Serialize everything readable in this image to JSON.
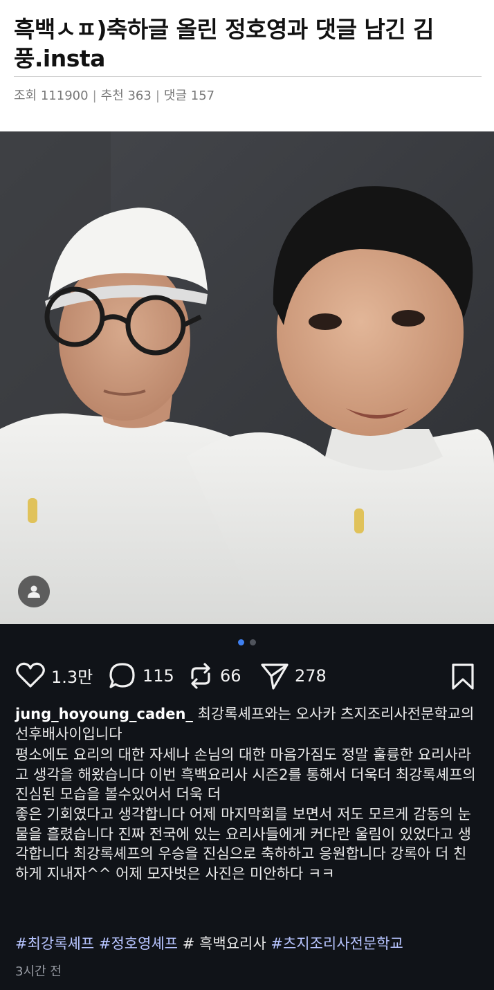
{
  "post": {
    "title": "흑백ㅅㅍ)축하글 올린 정호영과 댓글 남긴 김풍.insta",
    "stats": {
      "views_label": "조회 111900",
      "likes_label": "추천 363",
      "comments_label": "댓글 157"
    }
  },
  "photo": {
    "icon": "user-tag-icon",
    "carousel_total": 2,
    "carousel_current": 1
  },
  "instagram": {
    "actions": {
      "likes": "1.3만",
      "comments": "115",
      "reposts": "66",
      "shares": "278"
    },
    "caption": {
      "username": "jung_hoyoung_caden_",
      "line1": "최강록셰프와는 오사카 츠지조리사전문학교의 선후배사이입니다",
      "para2": "평소에도 요리의 대한 자세나 손님의 대한 마음가짐도 정말 훌륭한 요리사라고 생각을 해왔습니다 이번 흑백요리사 시즌2를 통해서 더욱더 최강록셰프의 진심된 모습을 볼수있어서 더욱 더",
      "para3": "좋은 기회였다고 생각합니다 어제 마지막회를 보면서 저도 모르게 감동의 눈물을 흘렸습니다 진짜 전국에 있는 요리사들에게 커다란 울림이 있었다고 생각합니다 최강록셰프의 우승을 진심으로 축하하고 응원합니다 강록아 더 친하게 지내자^^ 어제 모자벗은 사진은 미안하다 ㅋㅋ"
    },
    "hashtags": {
      "tag1": "#최강록셰프",
      "tag2": "#정호영셰프",
      "plain": "# 흑백요리사",
      "tag3": "#츠지조리사전문학교"
    },
    "time": "3시간 전"
  },
  "colors": {
    "panel_bg": "#101318",
    "hashtag": "#b7c4ff",
    "carousel_active": "#3f80f0"
  }
}
